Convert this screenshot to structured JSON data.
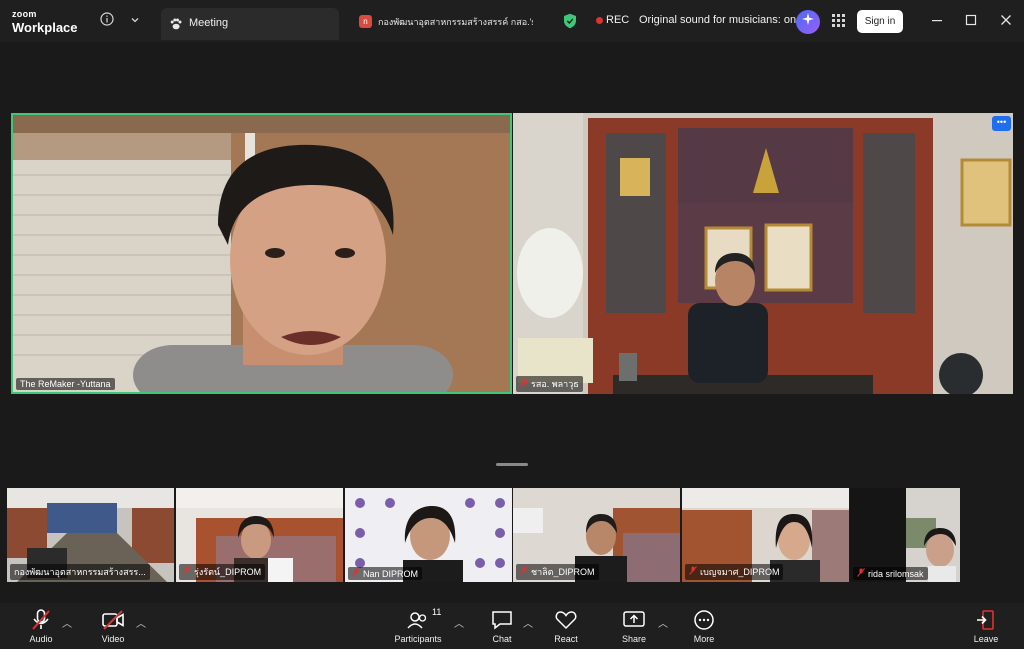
{
  "app": {
    "logo_top": "zoom",
    "logo_bottom": "Workplace"
  },
  "tabs": {
    "meeting_label": "Meeting",
    "second_tab_badge": "n",
    "second_tab_label": "กองพัฒนาอุตสาหกรรมสร้างสรรค์ กสอ.'s s"
  },
  "status": {
    "rec_label": "REC",
    "original_sound": "Original sound for musicians: on"
  },
  "header": {
    "sign_in_label": "Sign in"
  },
  "participants_main": [
    {
      "name": "The ReMaker -Yuttana",
      "muted": false
    },
    {
      "name": "รสอ. พลาวุธ",
      "muted": true
    }
  ],
  "participants_gallery": [
    {
      "name": "กองพัฒนาอุตสาหกรรมสร้างสรร...",
      "muted": false
    },
    {
      "name": "รุ่งรัตน์_DIPROM",
      "muted": true
    },
    {
      "name": "Nan DIPROM",
      "muted": true
    },
    {
      "name": "ชาลิต_DIPROM",
      "muted": true
    },
    {
      "name": "เบญจมาศ_DIPROM",
      "muted": true
    },
    {
      "name": "rida srilomsak",
      "muted": true
    }
  ],
  "toolbar": {
    "audio": "Audio",
    "video": "Video",
    "participants": "Participants",
    "participants_count": "11",
    "chat": "Chat",
    "react": "React",
    "share": "Share",
    "more": "More",
    "leave": "Leave"
  },
  "colors": {
    "active_speaker_border": "#3ec776",
    "rec_red": "#e0322f",
    "leave_red": "#e0322f",
    "more_badge_blue": "#1f6ef0"
  }
}
